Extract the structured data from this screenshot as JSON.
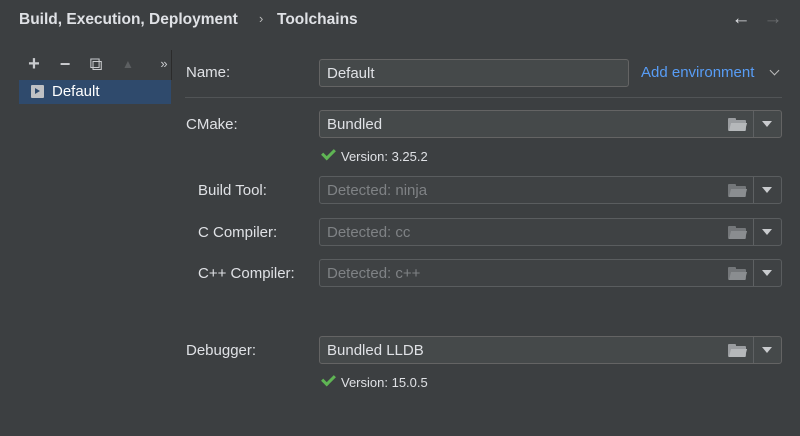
{
  "header": {
    "breadcrumb_parent": "Build, Execution, Deployment",
    "breadcrumb_separator": "›",
    "breadcrumb_current": "Toolchains",
    "back_icon": "←",
    "forward_icon": "→"
  },
  "toolbar": {
    "add": "+",
    "remove": "−",
    "copy": "⧉",
    "move_up": "▲",
    "more": "»"
  },
  "toolchains": [
    {
      "label": "Default",
      "icon": "run-config-icon",
      "selected": true
    }
  ],
  "form": {
    "name_label": "Name:",
    "name_value": "Default",
    "add_environment": "Add environment",
    "cmake_label": "CMake:",
    "cmake_value": "Bundled",
    "cmake_version": "Version: 3.25.2",
    "build_tool_label": "Build Tool:",
    "build_tool_value": "Detected: ninja",
    "c_compiler_label": "C Compiler:",
    "c_compiler_value": "Detected: cc",
    "cpp_compiler_label": "C++ Compiler:",
    "cpp_compiler_value": "Detected: c++",
    "debugger_label": "Debugger:",
    "debugger_value": "Bundled LLDB",
    "debugger_version": "Version: 15.0.5"
  },
  "colors": {
    "background": "#3c3f41",
    "selection": "#2f4a6c",
    "link": "#589df6",
    "check": "#5fb554"
  }
}
